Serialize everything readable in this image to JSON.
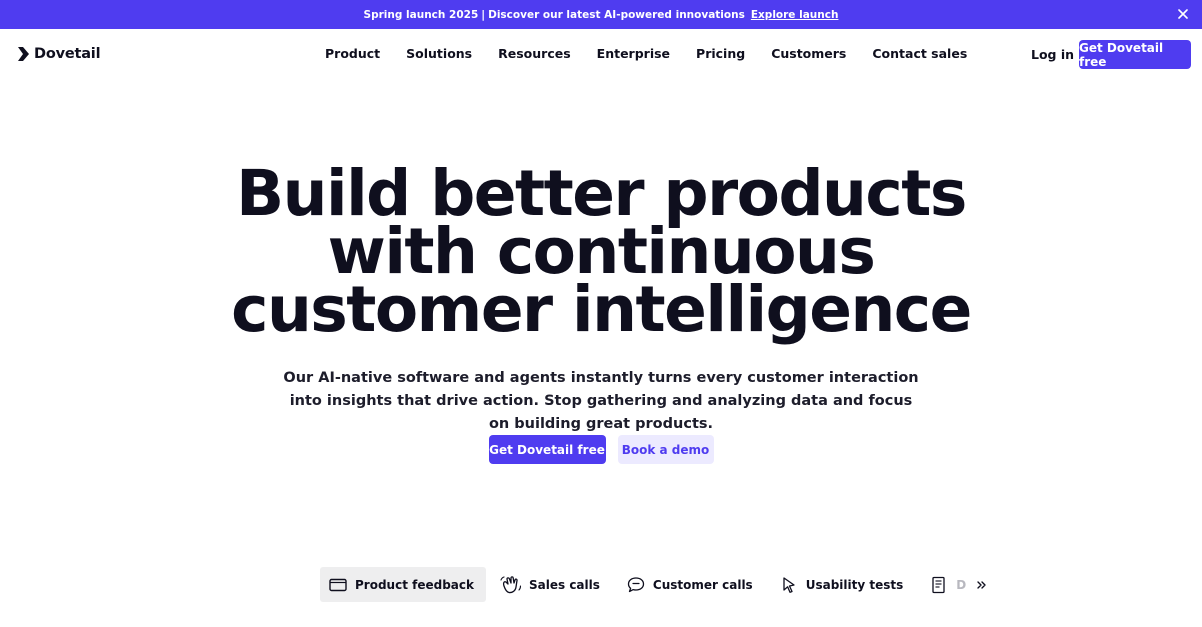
{
  "announcement": {
    "text": "Spring launch 2025",
    "separator": "|",
    "detail": "Discover our latest AI-powered innovations",
    "link": "Explore launch",
    "close_icon": "close-icon"
  },
  "header": {
    "logo": "Dovetail",
    "nav": [
      "Product",
      "Solutions",
      "Resources",
      "Enterprise",
      "Pricing",
      "Customers",
      "Contact sales"
    ],
    "login": "Log in",
    "cta": "Get Dovetail free"
  },
  "hero": {
    "title_lines": [
      "Build better products",
      "with continuous",
      "customer intelligence"
    ],
    "subtitle": "Our AI-native software and agents instantly turns every customer interaction into insights that drive action. Stop gathering and analyzing data and focus on building great products.",
    "primary_cta": "Get Dovetail free",
    "secondary_cta": "Book a demo"
  },
  "tabs": {
    "items": [
      {
        "label": "Product feedback",
        "icon": "window-icon",
        "active": true
      },
      {
        "label": "Sales calls",
        "icon": "wave-hand-icon",
        "active": false
      },
      {
        "label": "Customer calls",
        "icon": "chat-bubble-icon",
        "active": false
      },
      {
        "label": "Usability tests",
        "icon": "cursor-icon",
        "active": false
      },
      {
        "label": "D",
        "icon": "document-icon",
        "active": false
      }
    ],
    "more_icon": "chevrons-right-icon"
  },
  "colors": {
    "brand": "#4f3cf0",
    "text": "#0f0f1e",
    "secondary_bg": "#eceaff"
  }
}
